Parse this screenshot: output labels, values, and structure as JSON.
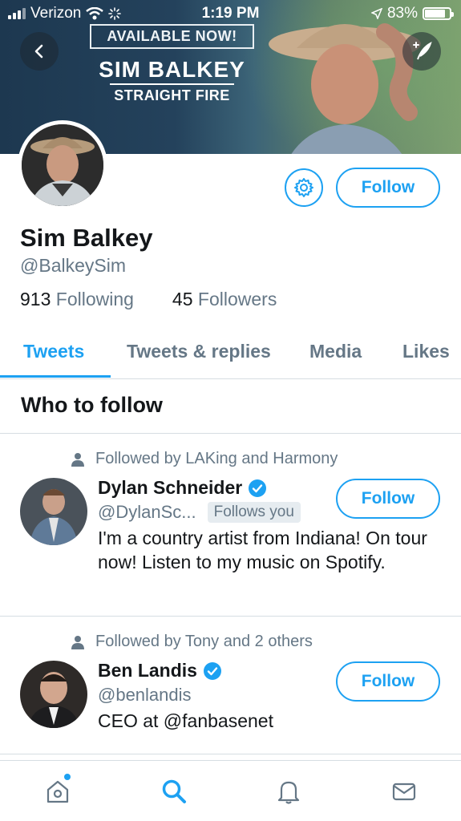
{
  "status_bar": {
    "carrier": "Verizon",
    "time": "1:19 PM",
    "battery": "83%",
    "battery_level": 0.83
  },
  "banner": {
    "promo_available": "AVAILABLE NOW!",
    "promo_artist": "SIM BALKEY",
    "promo_title": "STRAIGHT FIRE"
  },
  "profile": {
    "name": "Sim Balkey",
    "handle": "@BalkeySim",
    "following_count": "913",
    "following_label": "Following",
    "followers_count": "45",
    "followers_label": "Followers",
    "follow_label": "Follow"
  },
  "tabs": [
    {
      "label": "Tweets",
      "active": true
    },
    {
      "label": "Tweets & replies",
      "active": false
    },
    {
      "label": "Media",
      "active": false
    },
    {
      "label": "Likes",
      "active": false
    }
  ],
  "who_to_follow": {
    "title": "Who to follow",
    "suggestions": [
      {
        "context": "Followed by LAKing and Harmony",
        "name": "Dylan Schneider",
        "handle": "@DylanSc...",
        "follows_you": "Follows you",
        "bio": "I'm a country artist from Indiana! On tour now! Listen to my music on Spotify.",
        "follow_label": "Follow"
      },
      {
        "context": "Followed by Tony and 2 others",
        "name": "Ben Landis",
        "handle": "@benlandis",
        "bio": "CEO at @fanbasenet",
        "follow_label": "Follow"
      }
    ]
  },
  "colors": {
    "accent": "#1da1f2",
    "secondary_text": "#657786",
    "primary_text": "#14171a"
  },
  "icons": [
    "back-arrow-icon",
    "compose-tweet-icon",
    "settings-gear-icon",
    "person-icon",
    "verified-badge-icon",
    "home-icon",
    "search-icon",
    "notifications-bell-icon",
    "messages-envelope-icon"
  ]
}
